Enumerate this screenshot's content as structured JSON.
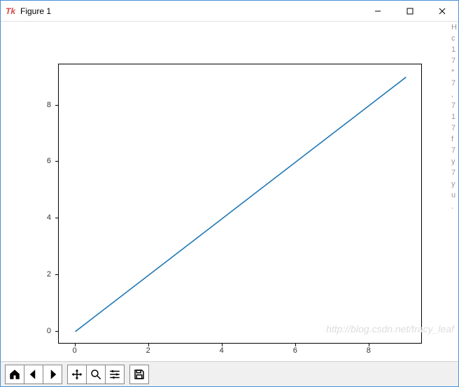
{
  "window": {
    "title": "Figure 1"
  },
  "chart_data": {
    "type": "line",
    "x": [
      0,
      1,
      2,
      3,
      4,
      5,
      6,
      7,
      8,
      9
    ],
    "y": [
      0,
      1,
      2,
      3,
      4,
      5,
      6,
      7,
      8,
      9
    ],
    "xlim": [
      -0.45,
      9.45
    ],
    "ylim": [
      -0.45,
      9.45
    ],
    "xticks": [
      0,
      2,
      4,
      6,
      8
    ],
    "yticks": [
      0,
      2,
      4,
      6,
      8
    ],
    "line_color": "#1f77b4",
    "title": "",
    "xlabel": "",
    "ylabel": ""
  },
  "toolbar": {
    "home": "Home",
    "back": "Back",
    "forward": "Forward",
    "pan": "Pan",
    "zoom": "Zoom",
    "configure": "Configure subplots",
    "save": "Save"
  },
  "watermark": "http://blog.csdn.net/tracy_leaf",
  "side_chars": [
    "H",
    "c",
    "1",
    "7",
    "*",
    "7",
    ",",
    "7",
    "1",
    "7",
    "f",
    "7",
    "y",
    "7",
    "",
    "y",
    "u",
    "."
  ]
}
